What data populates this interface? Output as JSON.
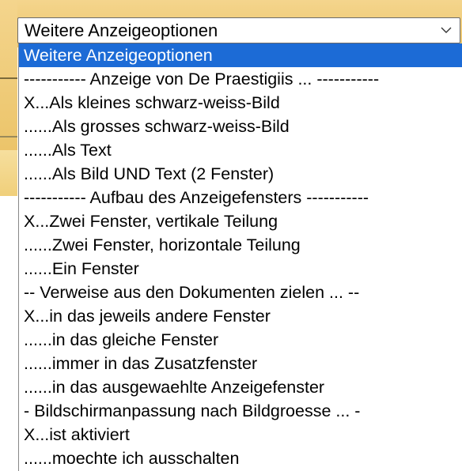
{
  "select": {
    "value": "Weitere Anzeigeoptionen",
    "chevron_icon": "chevron-down-icon"
  },
  "dropdown": {
    "options": [
      {
        "label": "Weitere Anzeigeoptionen",
        "selected": true
      },
      {
        "label": "----------- Anzeige von De Praestigiis ... -----------",
        "selected": false
      },
      {
        "label": "X...Als kleines schwarz-weiss-Bild",
        "selected": false
      },
      {
        "label": "......Als grosses schwarz-weiss-Bild",
        "selected": false
      },
      {
        "label": "......Als Text",
        "selected": false
      },
      {
        "label": "......Als Bild UND Text (2 Fenster)",
        "selected": false
      },
      {
        "label": "----------- Aufbau des Anzeigefensters -----------",
        "selected": false
      },
      {
        "label": "X...Zwei Fenster, vertikale Teilung",
        "selected": false
      },
      {
        "label": "......Zwei Fenster, horizontale Teilung",
        "selected": false
      },
      {
        "label": "......Ein Fenster",
        "selected": false
      },
      {
        "label": "-- Verweise aus den Dokumenten zielen ... --",
        "selected": false
      },
      {
        "label": "X...in das jeweils andere Fenster",
        "selected": false
      },
      {
        "label": "......in das gleiche Fenster",
        "selected": false
      },
      {
        "label": "......immer in das Zusatzfenster",
        "selected": false
      },
      {
        "label": "......in das ausgewaehlte Anzeigefenster",
        "selected": false
      },
      {
        "label": "- Bildschirmanpassung nach Bildgroesse ... -",
        "selected": false
      },
      {
        "label": "X...ist aktiviert",
        "selected": false
      },
      {
        "label": "......moechte ich ausschalten",
        "selected": false
      }
    ]
  },
  "colors": {
    "selected_bg": "#1c6bd6",
    "page_bg_accent": "#f4d58d"
  }
}
